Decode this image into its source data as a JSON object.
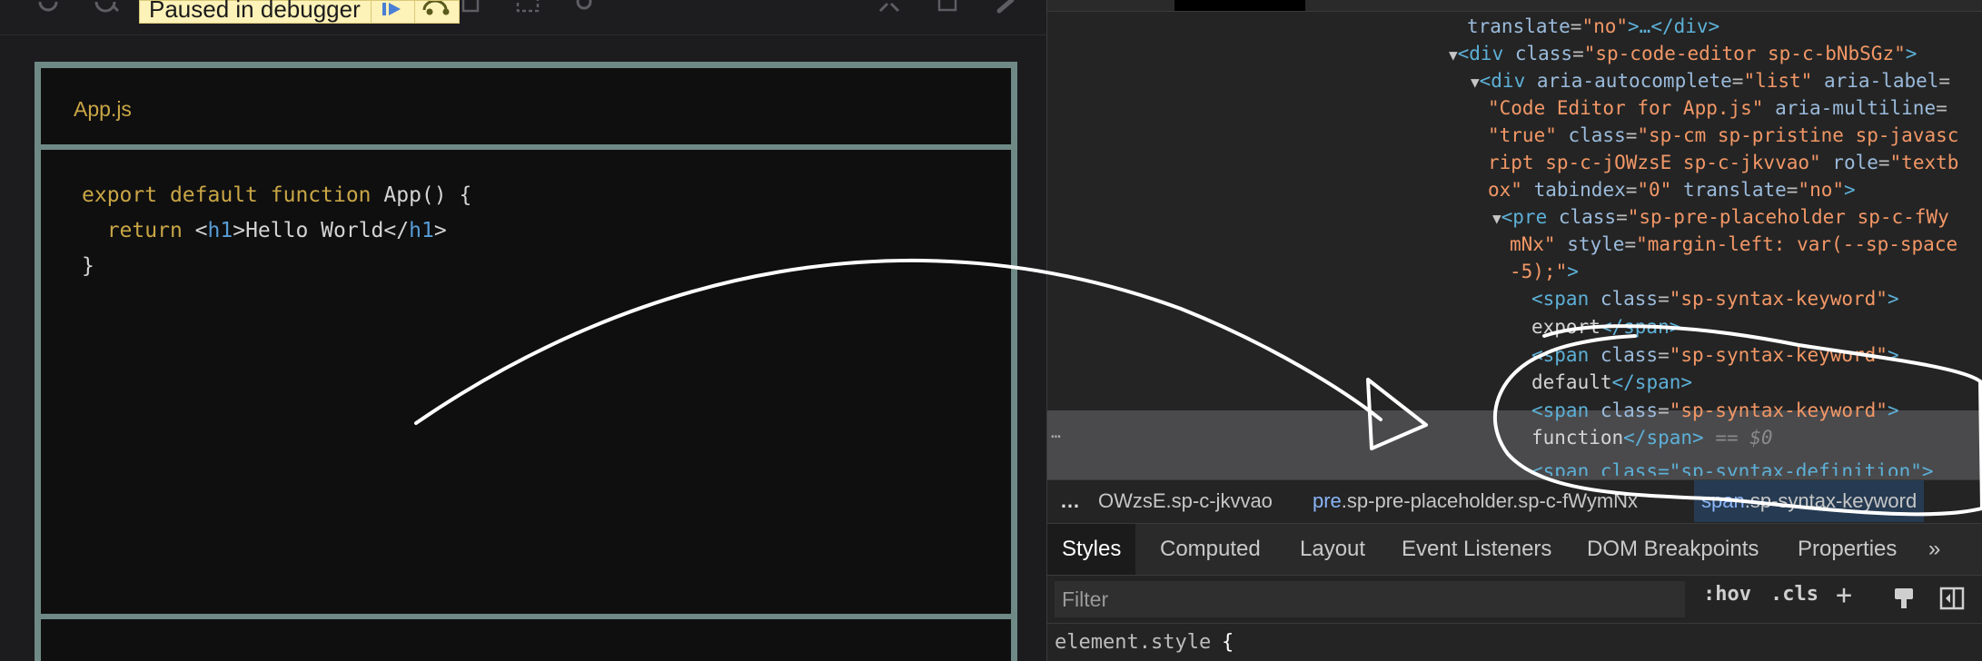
{
  "debugger": {
    "paused_text": "Paused in debugger",
    "icons": [
      "refresh-icon",
      "search-icon",
      "resume-icon",
      "step-over-icon",
      "expand-icon",
      "window-icon",
      "link-icon"
    ]
  },
  "editor": {
    "tab_label": "App.js",
    "code": {
      "line1": {
        "kw1": "export",
        "kw2": "default",
        "kw3": "function",
        "rest": " App() {"
      },
      "line2": {
        "kw": "return",
        "lt": "<",
        "tag1": "h1",
        "gt": ">",
        "text": "Hello World",
        "lt2": "</",
        "tag2": "h1",
        "gt2": ">"
      },
      "line3": "}"
    }
  },
  "dom": {
    "l1": {
      "attr": "translate",
      "val": "\"no\"",
      "rest": ">…</div>"
    },
    "l2": {
      "open": "<div ",
      "attr": "class",
      "val": "\"sp-code-editor sp-c-bNbSGz\"",
      "close": ">"
    },
    "l3": {
      "open": "<div ",
      "a1": "aria-autocomplete",
      "v1": "\"list\"",
      "a2": " aria-label",
      "eq": "="
    },
    "l4": {
      "v": "\"Code Editor for App.js\"",
      "a": " aria-multiline",
      "eq": "="
    },
    "l5": {
      "v": "\"true\"",
      "a": " class",
      "eq": "=",
      "v2": "\"sp-cm sp-pristine sp-javasc"
    },
    "l6": {
      "v": "ript sp-c-jOWzsE sp-c-jkvvao\"",
      "a": " role",
      "eq": "=",
      "v2": "\"textb"
    },
    "l7": {
      "v": "ox\"",
      "a": " tabindex",
      "eq": "=",
      "v2": "\"0\"",
      "a2": " translate",
      "v3": "\"no\"",
      "close": ">"
    },
    "l8": {
      "open": "<pre ",
      "a": "class",
      "eq": "=",
      "v": "\"sp-pre-placeholder sp-c-fWy"
    },
    "l9": {
      "v": "mNx\"",
      "a": " style",
      "eq": "=",
      "v2": "\"margin-left: var(--sp-space"
    },
    "l10": {
      "v": "-5);\"",
      "close": ">"
    },
    "span_open": "<span ",
    "span_attr": "class",
    "span_val": "\"sp-syntax-keyword\"",
    "span_close": ">",
    "export_text": "export",
    "default_text": "default",
    "function_text": "function",
    "end_span": "</span>",
    "eq_marker": " == $0",
    "l18": "<span class=\"sp-syntax-definition\">",
    "dots": "…"
  },
  "breadcrumbs": {
    "more": "…",
    "item1": "OWzsE.sp-c-jkvvao",
    "item2_tag": "pre",
    "item2_rest": ".sp-pre-placeholder.sp-c-fWymNx",
    "item3_tag": "span",
    "item3_rest": ".sp-syntax-keyword"
  },
  "tabs": [
    "Styles",
    "Computed",
    "Layout",
    "Event Listeners",
    "DOM Breakpoints",
    "Properties",
    "»"
  ],
  "filter": {
    "placeholder": "Filter",
    "hov": ":hov",
    "cls": ".cls",
    "plus": "+"
  },
  "styles": {
    "selector": "element.style",
    "brace": "{"
  }
}
